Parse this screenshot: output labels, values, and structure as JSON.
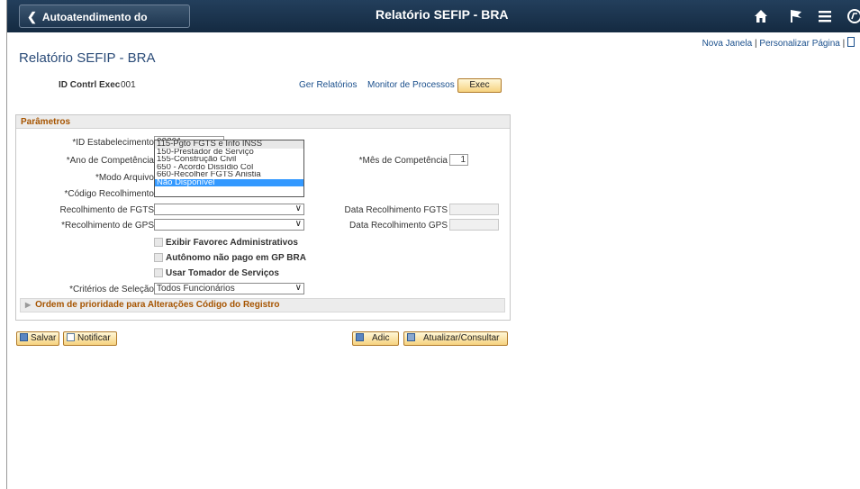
{
  "header": {
    "back_label": "Autoatendimento do Gerente",
    "title": "Relatório SEFIP - BRA"
  },
  "links": {
    "new_window": "Nova Janela",
    "separator": "|",
    "personalize": "Personalizar Página"
  },
  "page": {
    "title": "Relatório SEFIP - BRA"
  },
  "run_control": {
    "label": "ID Contrl Exec",
    "value": "001",
    "report_manager": "Ger Relatórios",
    "process_monitor": "Monitor de Processos",
    "run_button": "Exec"
  },
  "params": {
    "header": "Parâmetros",
    "establishment_label": "*ID Estabelecimento",
    "establishment_value": "02301",
    "year_label": "*Ano de Competência",
    "month_label": "*Mês de Competência",
    "month_value": "1",
    "file_mode_label": "*Modo Arquivo",
    "collection_code_label": "*Código Recolhimento",
    "fgts_label": "Recolhimento de FGTS",
    "fgts_value": "",
    "fgts_date_label": "Data Recolhimento FGTS",
    "gps_label": "*Recolhimento de GPS",
    "gps_value": "",
    "gps_date_label": "Data Recolhimento GPS",
    "cb_admin": "Exibir Favorec Administrativos",
    "cb_autonomo": "Autônomo não pago em GP BRA",
    "cb_tomador": "Usar Tomador de Serviços",
    "criteria_label": "*Critérios de Seleção",
    "criteria_value": "Todos Funcionários",
    "priority_section": "Ordem de prioridade para Alterações Código do Registro"
  },
  "dropdown": {
    "options": [
      "115-Pgto FGTS e Info INSS",
      "150-Prestador de Serviço",
      "155-Construção Civil",
      "650 - Acordo Dissídio Col",
      "660-Recolher FGTS Anistia",
      "Não Disponível"
    ],
    "selected": "Não Disponível"
  },
  "toolbar": {
    "save": "Salvar",
    "notify": "Notificar",
    "add": "Adic",
    "update": "Atualizar/Consultar"
  },
  "colors": {
    "header_bg": "#1b3550",
    "accent_orange": "#a65400",
    "link_blue": "#1a4f8c",
    "selected_blue": "#3399ff"
  }
}
